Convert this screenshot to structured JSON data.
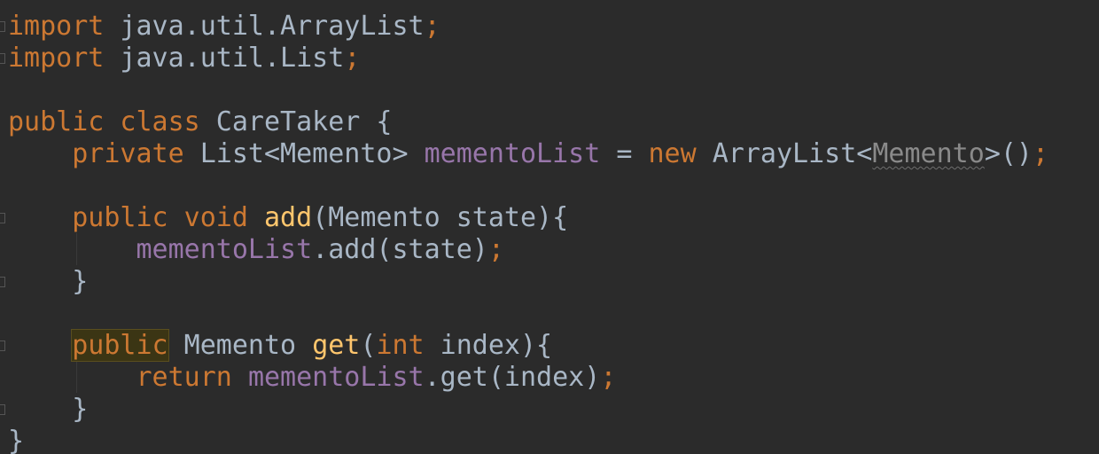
{
  "editor": {
    "language": "Java",
    "theme": "Darcula",
    "colors": {
      "background": "#2b2b2b",
      "keyword": "#cc7832",
      "plain": "#a9b7c6",
      "field": "#9876aa",
      "method": "#ffc66d"
    },
    "lines": [
      [
        {
          "t": "import",
          "c": "kw"
        },
        {
          "t": " java.util.ArrayList",
          "c": "plain"
        },
        {
          "t": ";",
          "c": "punct"
        }
      ],
      [
        {
          "t": "import",
          "c": "kw"
        },
        {
          "t": " java.util.List",
          "c": "plain"
        },
        {
          "t": ";",
          "c": "punct"
        }
      ],
      [],
      [
        {
          "t": "public class",
          "c": "kw"
        },
        {
          "t": " CareTaker {",
          "c": "plain"
        }
      ],
      [
        {
          "t": "    "
        },
        {
          "t": "private",
          "c": "kw"
        },
        {
          "t": " List<Memento> ",
          "c": "plain"
        },
        {
          "t": "mementoList",
          "c": "field"
        },
        {
          "t": " = ",
          "c": "plain"
        },
        {
          "t": "new",
          "c": "kw"
        },
        {
          "t": " ArrayList<",
          "c": "plain"
        },
        {
          "t": "Memento",
          "c": "warn"
        },
        {
          "t": ">()",
          "c": "plain"
        },
        {
          "t": ";",
          "c": "punct"
        }
      ],
      [],
      [
        {
          "t": "    "
        },
        {
          "t": "public void",
          "c": "kw"
        },
        {
          "t": " "
        },
        {
          "t": "add",
          "c": "method"
        },
        {
          "t": "(Memento state){",
          "c": "plain"
        }
      ],
      [
        {
          "t": "        "
        },
        {
          "t": "mementoList",
          "c": "field"
        },
        {
          "t": ".add(state)",
          "c": "plain"
        },
        {
          "t": ";",
          "c": "punct"
        }
      ],
      [
        {
          "t": "    }",
          "c": "plain"
        }
      ],
      [],
      [
        {
          "t": "    "
        },
        {
          "t": "public",
          "c": "kw hl"
        },
        {
          "t": " Memento ",
          "c": "plain"
        },
        {
          "t": "get",
          "c": "method"
        },
        {
          "t": "(",
          "c": "plain"
        },
        {
          "t": "int",
          "c": "kw"
        },
        {
          "t": " index){",
          "c": "plain"
        }
      ],
      [
        {
          "t": "        "
        },
        {
          "t": "return",
          "c": "kw"
        },
        {
          "t": " "
        },
        {
          "t": "mementoList",
          "c": "field"
        },
        {
          "t": ".get(index)",
          "c": "plain"
        },
        {
          "t": ";",
          "c": "punct"
        }
      ],
      [
        {
          "t": "    }",
          "c": "plain"
        }
      ],
      [
        {
          "t": "}",
          "c": "plain"
        }
      ]
    ]
  }
}
